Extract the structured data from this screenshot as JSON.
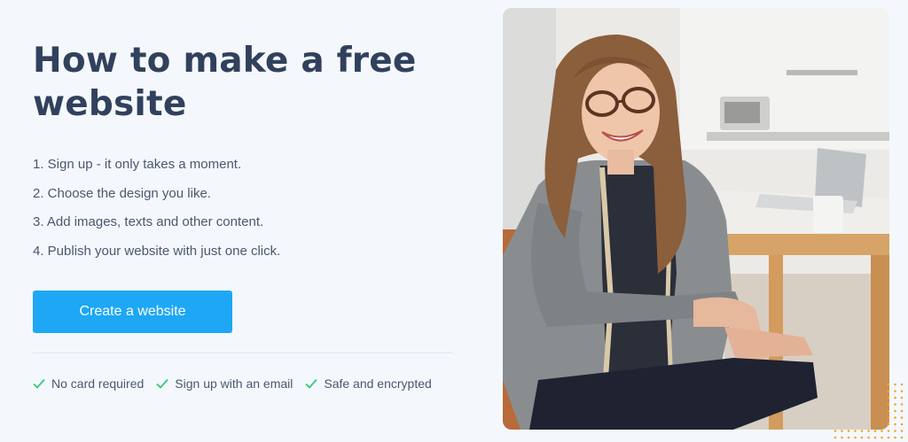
{
  "hero": {
    "title": "How to make a free website",
    "steps": [
      "1. Sign up - it only takes a moment.",
      "2. Choose the design you like.",
      "3. Add images, texts and other content.",
      "4. Publish your website with just one click."
    ],
    "cta_label": "Create a website",
    "features": [
      "No card required",
      "Sign up with an email",
      "Safe and encrypted"
    ]
  },
  "colors": {
    "background": "#f4f8fd",
    "title": "#31415d",
    "body_text": "#4b5770",
    "cta": "#1ea7f5",
    "check": "#2ecc71",
    "dots": "#f5a623"
  },
  "icons": {
    "feature_check": "check-icon",
    "photo": "smiling-woman-photo"
  }
}
